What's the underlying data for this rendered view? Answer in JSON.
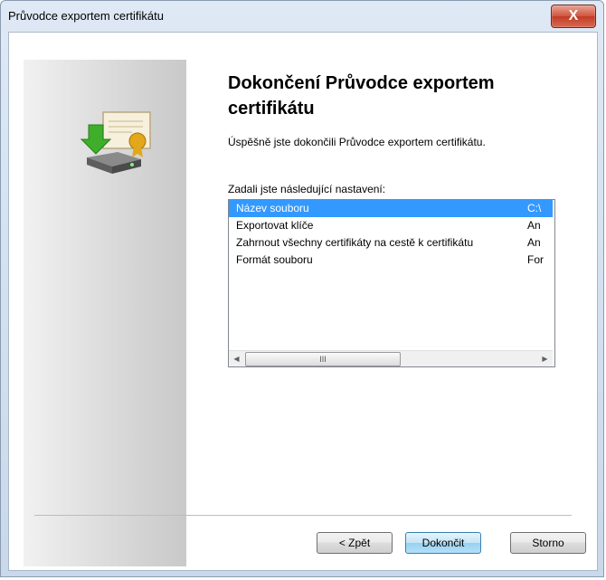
{
  "window": {
    "title": "Průvodce exportem certifikátu",
    "close_glyph": "X"
  },
  "main": {
    "heading": "Dokončení Průvodce exportem certifikátu",
    "success_text": "Úspěšně jste dokončili Průvodce exportem certifikátu.",
    "settings_label": "Zadali jste následující nastavení:",
    "settings": [
      {
        "name": "Název souboru",
        "value": "C:\\",
        "selected": true
      },
      {
        "name": "Exportovat klíče",
        "value": "An",
        "selected": false
      },
      {
        "name": "Zahrnout všechny certifikáty na cestě k certifikátu",
        "value": "An",
        "selected": false
      },
      {
        "name": "Formát souboru",
        "value": "For",
        "selected": false
      }
    ],
    "scrollbar": {
      "left": "◀",
      "thumb": "III",
      "right": "▶"
    }
  },
  "buttons": {
    "back": "< Zpět",
    "finish": "Dokončit",
    "cancel": "Storno"
  },
  "icons": {
    "side": "certificate-export-icon"
  }
}
